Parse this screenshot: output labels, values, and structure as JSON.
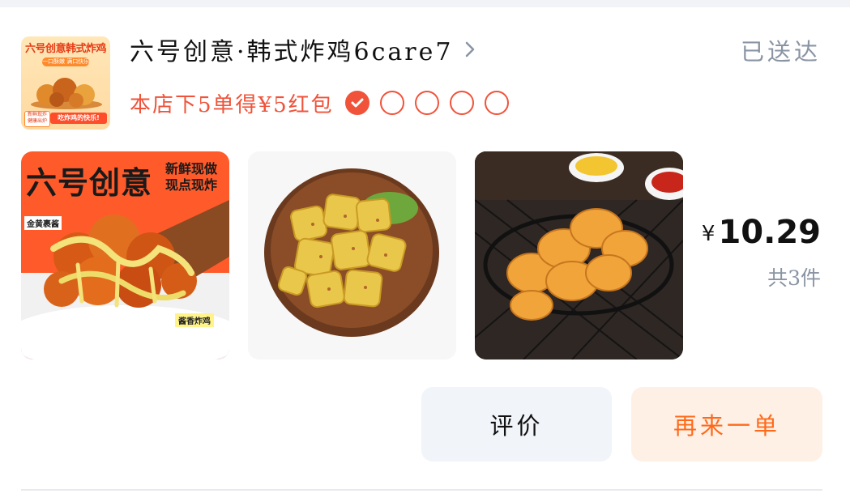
{
  "order": {
    "store_name": "六号创意·韩式炸鸡6care7",
    "status": "已送达",
    "promo": {
      "text": "本店下5单得¥5红包",
      "completed": 1,
      "total": 5
    },
    "logo": {
      "title": "六号创意韩式炸鸡",
      "pill": "一口酥嫩 满口快乐",
      "bottom": "吃炸鸡的快乐!",
      "tag": "新鲜现炸 健康出炉"
    },
    "products": [
      {
        "name": "fried-chicken-image",
        "banner_title": "六号创意",
        "banner_sub_1": "新鲜现做",
        "banner_sub_2": "现点现炸",
        "tag_left": "金黄裹酱",
        "tag_right": "酱香炸鸡"
      },
      {
        "name": "potato-bites-image"
      },
      {
        "name": "chicken-nuggets-image"
      }
    ],
    "price": {
      "currency": "¥",
      "amount": "10.29"
    },
    "count_text": "共3件",
    "buttons": {
      "review": "评价",
      "reorder": "再来一单"
    }
  },
  "colors": {
    "accent": "#f0533a",
    "reorder_text": "#ff6a1a",
    "muted": "#8a94a3"
  }
}
